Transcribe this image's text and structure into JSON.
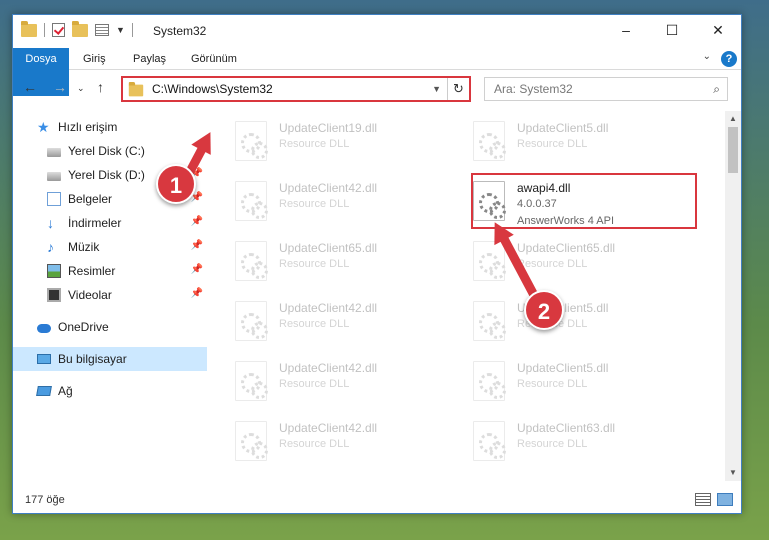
{
  "window": {
    "title": "System32",
    "controls": [
      "–",
      "☐",
      "✕"
    ]
  },
  "ribbon": {
    "tabs": [
      "Dosya",
      "Giriş",
      "Paylaş",
      "Görünüm"
    ],
    "help_label": "?",
    "collapse_icon": "chevron-down-icon"
  },
  "address": {
    "path": "C:\\Windows\\System32",
    "search_placeholder": "Ara: System32"
  },
  "nav": {
    "items": [
      {
        "label": "Hızlı erişim",
        "icon": "star-icon"
      },
      {
        "label": "Yerel Disk (C:)",
        "icon": "drive-icon",
        "pinned": true
      },
      {
        "label": "Yerel Disk (D:)",
        "icon": "drive-icon",
        "pinned": true
      },
      {
        "label": "Belgeler",
        "icon": "documents-icon",
        "pinned": true
      },
      {
        "label": "İndirmeler",
        "icon": "downloads-icon",
        "pinned": true
      },
      {
        "label": "Müzik",
        "icon": "music-icon",
        "pinned": true
      },
      {
        "label": "Resimler",
        "icon": "pictures-icon",
        "pinned": true
      },
      {
        "label": "Videolar",
        "icon": "videos-icon",
        "pinned": true
      },
      {
        "label": "OneDrive",
        "icon": "onedrive-icon"
      },
      {
        "label": "Bu bilgisayar",
        "icon": "this-pc-icon",
        "selected": true
      },
      {
        "label": "Ağ",
        "icon": "network-icon"
      }
    ]
  },
  "files": [
    {
      "name": "UpdateClient19.dll",
      "sub": "Resource DLL"
    },
    {
      "name": "UpdateClient5.dll",
      "sub": "Resource DLL"
    },
    {
      "name": "UpdateClient42.dll",
      "sub": "Resource DLL"
    },
    {
      "name": "awapi4.dll",
      "sub": "4.0.0.37",
      "sub2": "AnswerWorks 4 API",
      "highlighted": true
    },
    {
      "name": "UpdateClient65.dll",
      "sub": "Resource DLL"
    },
    {
      "name": "UpdateClient65.dll",
      "sub": "Resource DLL"
    },
    {
      "name": "UpdateClient42.dll",
      "sub": "Resource DLL"
    },
    {
      "name": "UpdateClient5.dll",
      "sub": "Resource DLL"
    },
    {
      "name": "UpdateClient42.dll",
      "sub": "Resource DLL"
    },
    {
      "name": "UpdateClient5.dll",
      "sub": "Resource DLL"
    },
    {
      "name": "UpdateClient42.dll",
      "sub": "Resource DLL"
    },
    {
      "name": "UpdateClient63.dll",
      "sub": "Resource DLL"
    }
  ],
  "status": {
    "count": "177 öğe"
  },
  "annotations": {
    "step1": "1",
    "step2": "2",
    "accent": "#d8383f"
  }
}
